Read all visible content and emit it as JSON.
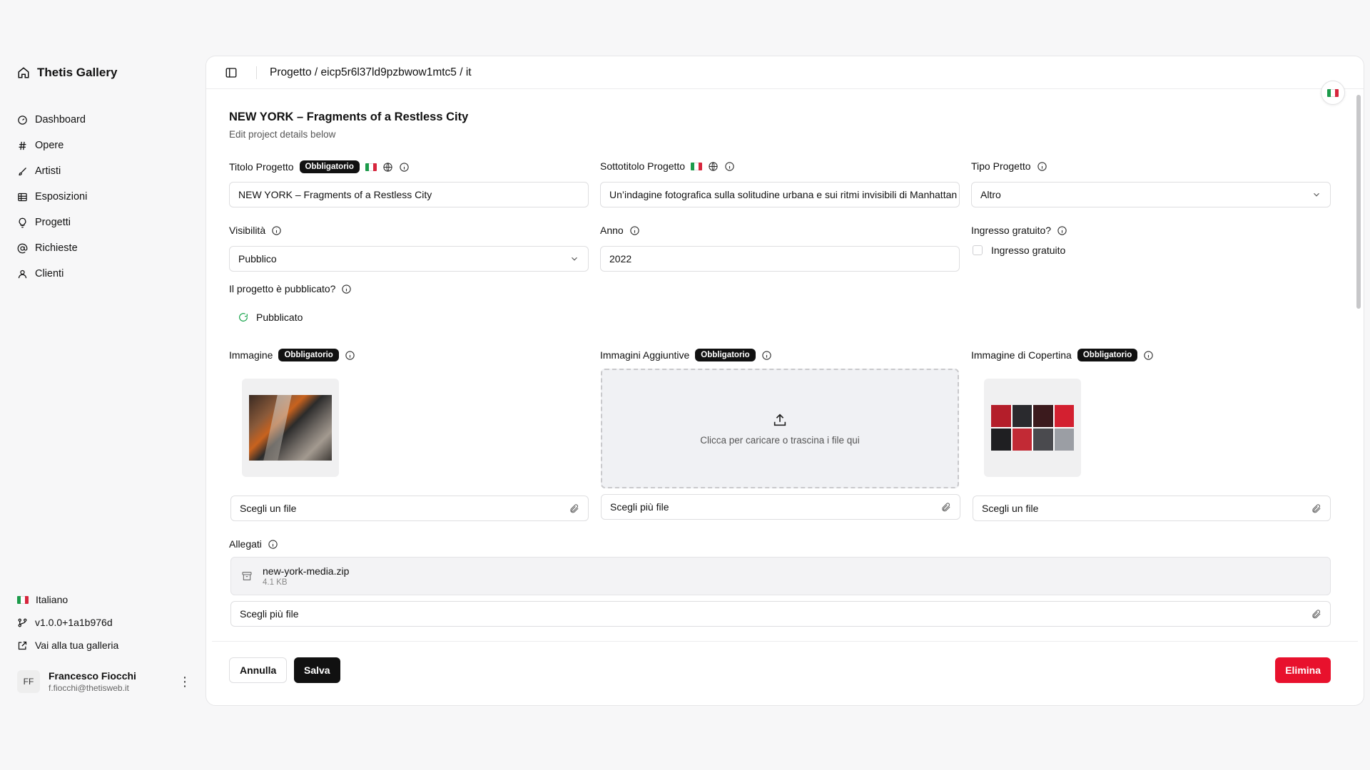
{
  "app": {
    "name": "Thetis Gallery",
    "brand_icon": "home-icon"
  },
  "sidebar": {
    "items": [
      {
        "label": "Dashboard",
        "icon": "dashboard-icon"
      },
      {
        "label": "Opere",
        "icon": "hash-icon"
      },
      {
        "label": "Artisti",
        "icon": "brush-icon"
      },
      {
        "label": "Esposizioni",
        "icon": "grid-icon"
      },
      {
        "label": "Progetti",
        "icon": "lightbulb-icon"
      },
      {
        "label": "Richieste",
        "icon": "at-icon"
      },
      {
        "label": "Clienti",
        "icon": "user-icon"
      }
    ],
    "language": "Italiano",
    "version": "v1.0.0+1a1b976d",
    "gallery_link": "Vai alla tua galleria"
  },
  "user": {
    "initials": "FF",
    "name": "Francesco Fiocchi",
    "email": "f.fiocchi@thetisweb.it"
  },
  "header": {
    "breadcrumb": "Progetto / eicp5r6l37ld9pzbwow1mtc5 / it"
  },
  "form": {
    "title": "NEW YORK – Fragments of a Restless City",
    "subtitle": "Edit project details below",
    "required_badge": "Obbligatorio",
    "project_title": {
      "label": "Titolo Progetto",
      "value": "NEW YORK – Fragments of a Restless City"
    },
    "project_subtitle": {
      "label": "Sottotitolo Progetto",
      "value": "Un’indagine fotografica sulla solitudine urbana e sui ritmi invisibili di Manhattan"
    },
    "project_type": {
      "label": "Tipo Progetto",
      "value": "Altro"
    },
    "visibility": {
      "label": "Visibilità",
      "value": "Pubblico"
    },
    "year": {
      "label": "Anno",
      "value": "2022"
    },
    "free_entry": {
      "label": "Ingresso gratuito?",
      "checkbox_label": "Ingresso gratuito",
      "checked": false
    },
    "published": {
      "label": "Il progetto è pubblicato?",
      "status": "Pubblicato"
    },
    "image": {
      "label": "Immagine",
      "file_button": "Scegli un file"
    },
    "additional_images": {
      "label": "Immagini Aggiuntive",
      "dropzone_text": "Clicca per caricare o trascina i file qui",
      "file_button": "Scegli più file"
    },
    "cover_image": {
      "label": "Immagine di Copertina",
      "file_button": "Scegli un file"
    },
    "attachments": {
      "label": "Allegati",
      "files": [
        {
          "name": "new-york-media.zip",
          "size": "4.1 KB"
        }
      ],
      "file_button": "Scegli più file"
    }
  },
  "actions": {
    "cancel": "Annulla",
    "save": "Salva",
    "delete": "Elimina"
  },
  "colors": {
    "primary": "#111111",
    "danger": "#e8112d",
    "success": "#16a34a"
  }
}
